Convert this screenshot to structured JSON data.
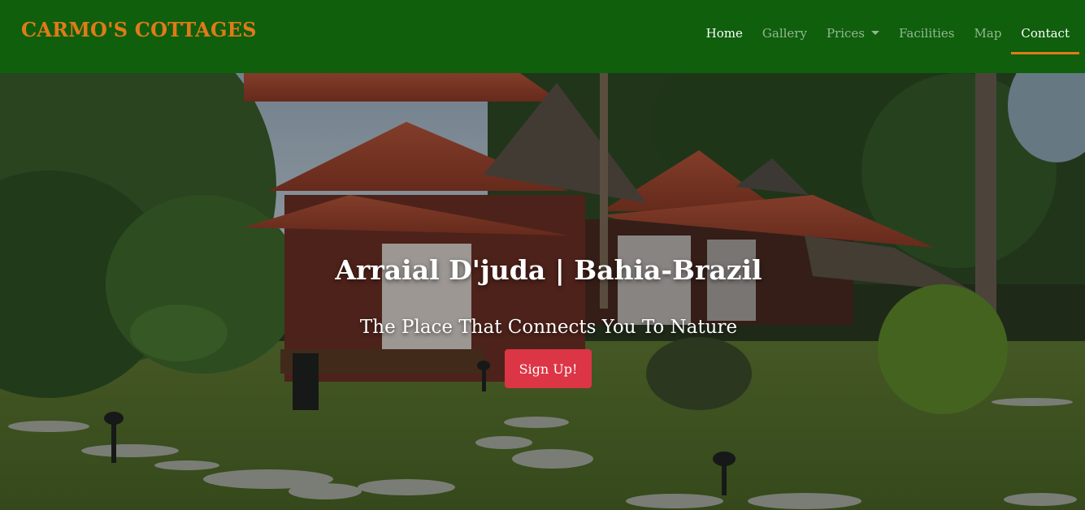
{
  "brand": "CARMO'S COTTAGES",
  "nav": {
    "items": [
      {
        "label": "Home"
      },
      {
        "label": "Gallery"
      },
      {
        "label": "Prices"
      },
      {
        "label": "Facilities"
      },
      {
        "label": "Map"
      },
      {
        "label": "Contact"
      }
    ]
  },
  "hero": {
    "title": "Arraial D'juda | Bahia-Brazil",
    "subtitle": "The Place That Connects You To Nature",
    "cta_label": "Sign Up!"
  },
  "colors": {
    "navbar_bg": "#0f5f0c",
    "brand": "#e07a1a",
    "active_underline": "#e07a1a",
    "cta_bg": "#dc3545"
  },
  "icons": {
    "prices_dropdown": "caret-down-icon"
  }
}
